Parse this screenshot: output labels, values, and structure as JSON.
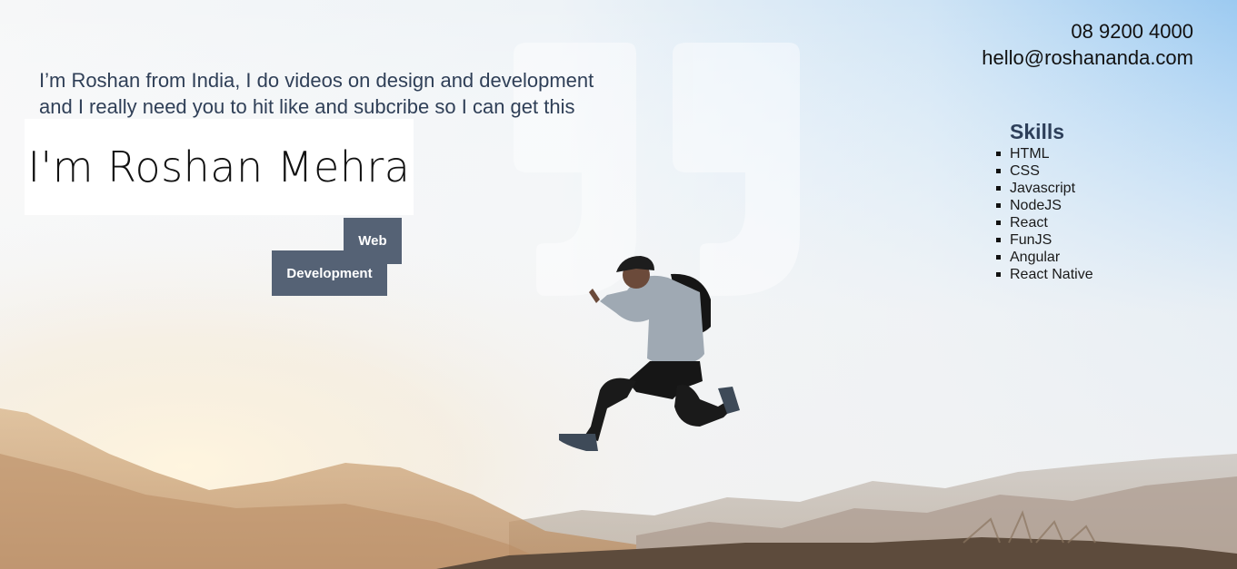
{
  "header": {
    "phone": "08 9200 4000",
    "email": "hello@roshananda.com"
  },
  "hero": {
    "intro_line1": "I’m Roshan from India, I do videos on design and development",
    "intro_line2": "and I really need you to hit like and subcribe so I can get this",
    "name": "I'm Roshan Mehra",
    "tags": [
      "Web",
      "Development"
    ]
  },
  "skills": {
    "title": "Skills",
    "items": [
      "HTML",
      "CSS",
      "Javascript",
      "NodeJS",
      "React",
      "FunJS",
      "Angular",
      "React Native"
    ]
  },
  "colors": {
    "sky": "#a9d4f5",
    "tag_background": "#556275",
    "heading": "#2d3f5a",
    "text": "#2f3f57"
  },
  "icons": {
    "quote": "quote-mark-icon",
    "list_bullet": "square-bullet-icon"
  },
  "background_image": "person-jumping-over-mountains"
}
